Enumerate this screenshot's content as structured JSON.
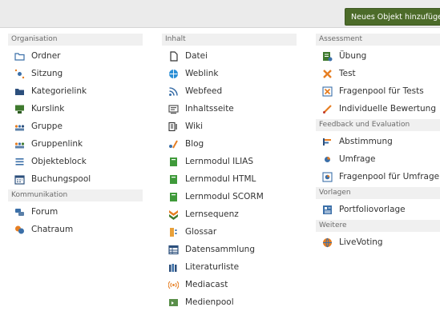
{
  "toolbar": {
    "add_label": "Neues Objekt hinzufügen"
  },
  "col1": {
    "organisation": {
      "header": "Organisation",
      "items": [
        {
          "label": "Ordner",
          "icon": "folder-icon"
        },
        {
          "label": "Sitzung",
          "icon": "session-icon"
        },
        {
          "label": "Kategorielink",
          "icon": "category-link-icon"
        },
        {
          "label": "Kurslink",
          "icon": "course-link-icon"
        },
        {
          "label": "Gruppe",
          "icon": "group-icon"
        },
        {
          "label": "Gruppenlink",
          "icon": "group-link-icon"
        },
        {
          "label": "Objekteblock",
          "icon": "object-block-icon"
        },
        {
          "label": "Buchungspool",
          "icon": "booking-pool-icon"
        }
      ]
    },
    "kommunikation": {
      "header": "Kommunikation",
      "items": [
        {
          "label": "Forum",
          "icon": "forum-icon"
        },
        {
          "label": "Chatraum",
          "icon": "chat-icon"
        }
      ]
    }
  },
  "col2": {
    "inhalt": {
      "header": "Inhalt",
      "items": [
        {
          "label": "Datei",
          "icon": "file-icon"
        },
        {
          "label": "Weblink",
          "icon": "weblink-icon"
        },
        {
          "label": "Webfeed",
          "icon": "rss-icon"
        },
        {
          "label": "Inhaltsseite",
          "icon": "content-page-icon"
        },
        {
          "label": "Wiki",
          "icon": "wiki-icon"
        },
        {
          "label": "Blog",
          "icon": "blog-icon"
        },
        {
          "label": "Lernmodul ILIAS",
          "icon": "learning-module-icon"
        },
        {
          "label": "Lernmodul HTML",
          "icon": "learning-module-html-icon"
        },
        {
          "label": "Lernmodul SCORM",
          "icon": "learning-module-scorm-icon"
        },
        {
          "label": "Lernsequenz",
          "icon": "learning-sequence-icon"
        },
        {
          "label": "Glossar",
          "icon": "glossary-icon"
        },
        {
          "label": "Datensammlung",
          "icon": "data-collection-icon"
        },
        {
          "label": "Literaturliste",
          "icon": "bibliography-icon"
        },
        {
          "label": "Mediacast",
          "icon": "mediacast-icon"
        },
        {
          "label": "Medienpool",
          "icon": "media-pool-icon"
        }
      ]
    }
  },
  "col3": {
    "assessment": {
      "header": "Assessment",
      "items": [
        {
          "label": "Übung",
          "icon": "exercise-icon"
        },
        {
          "label": "Test",
          "icon": "test-icon"
        },
        {
          "label": "Fragenpool für Tests",
          "icon": "question-pool-icon"
        },
        {
          "label": "Individuelle Bewertung",
          "icon": "individual-assessment-icon"
        }
      ]
    },
    "feedback": {
      "header": "Feedback und Evaluation",
      "items": [
        {
          "label": "Abstimmung",
          "icon": "poll-icon"
        },
        {
          "label": "Umfrage",
          "icon": "survey-icon"
        },
        {
          "label": "Fragenpool für Umfragen",
          "icon": "survey-pool-icon"
        }
      ]
    },
    "vorlagen": {
      "header": "Vorlagen",
      "items": [
        {
          "label": "Portfoliovorlage",
          "icon": "portfolio-template-icon"
        }
      ]
    },
    "weitere": {
      "header": "Weitere",
      "items": [
        {
          "label": "LiveVoting",
          "icon": "livevoting-icon"
        }
      ]
    }
  }
}
